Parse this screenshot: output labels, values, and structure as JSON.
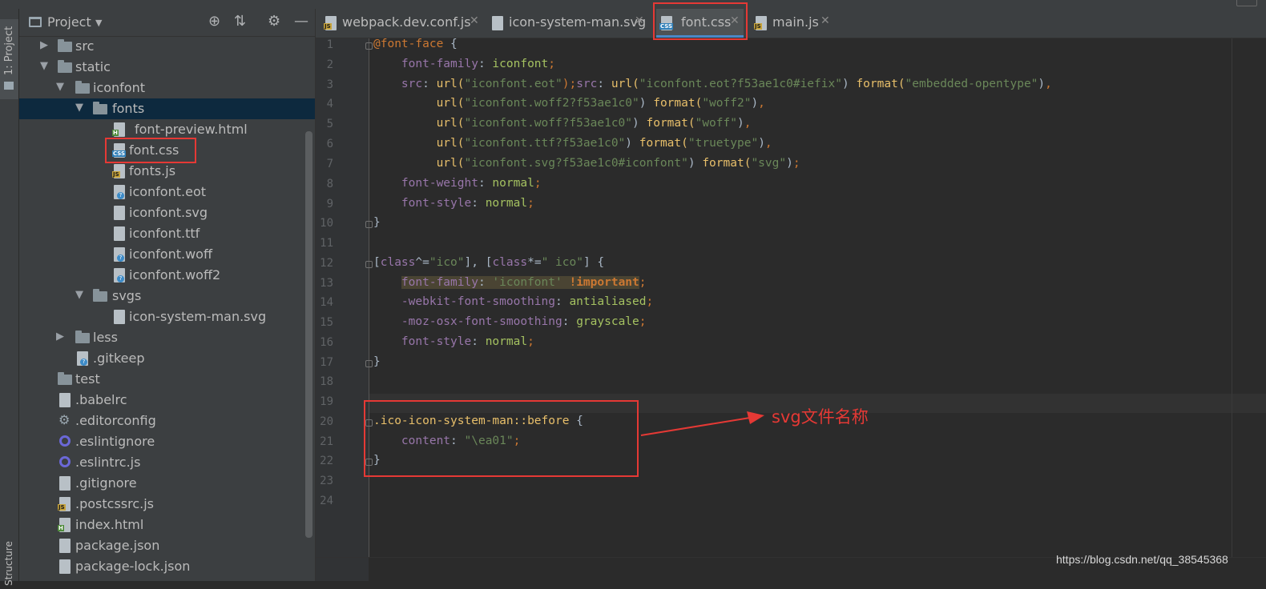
{
  "toolwindow_tabs": {
    "project": "1: Project",
    "structure": "Structure"
  },
  "project_panel": {
    "title": "Project",
    "dropdown_icon": "triangle-down",
    "header_icons": [
      "locate-icon",
      "collapse-icon",
      "gear-icon",
      "minimize-icon"
    ],
    "tree": [
      {
        "label": "src",
        "type": "folder",
        "expanded": false
      },
      {
        "label": "static",
        "type": "folder",
        "expanded": true
      },
      {
        "label": "iconfont",
        "type": "folder",
        "expanded": true
      },
      {
        "label": "fonts",
        "type": "folder",
        "expanded": true,
        "selected": true
      },
      {
        "label": "font-preview.html",
        "type": "html"
      },
      {
        "label": "font.css",
        "type": "css",
        "highlighted": true
      },
      {
        "label": "fonts.js",
        "type": "js"
      },
      {
        "label": "iconfont.eot",
        "type": "unknown"
      },
      {
        "label": "iconfont.svg",
        "type": "svg"
      },
      {
        "label": "iconfont.ttf",
        "type": "text"
      },
      {
        "label": "iconfont.woff",
        "type": "unknown"
      },
      {
        "label": "iconfont.woff2",
        "type": "unknown"
      },
      {
        "label": "svgs",
        "type": "folder",
        "expanded": true
      },
      {
        "label": "icon-system-man.svg",
        "type": "svg"
      },
      {
        "label": "less",
        "type": "folder",
        "expanded": false
      },
      {
        "label": ".gitkeep",
        "type": "unknown"
      },
      {
        "label": "test",
        "type": "folder"
      },
      {
        "label": ".babelrc",
        "type": "config"
      },
      {
        "label": ".editorconfig",
        "type": "gear"
      },
      {
        "label": ".eslintignore",
        "type": "eslint"
      },
      {
        "label": ".eslintrc.js",
        "type": "eslint"
      },
      {
        "label": ".gitignore",
        "type": "config"
      },
      {
        "label": ".postcssrc.js",
        "type": "js"
      },
      {
        "label": "index.html",
        "type": "html"
      },
      {
        "label": "package.json",
        "type": "config"
      },
      {
        "label": "package-lock.json",
        "type": "config"
      }
    ]
  },
  "editor_tabs": [
    {
      "label": "webpack.dev.conf.js",
      "type": "js",
      "active": false
    },
    {
      "label": "icon-system-man.svg",
      "type": "svg",
      "active": false
    },
    {
      "label": "font.css",
      "type": "css",
      "active": true
    },
    {
      "label": "main.js",
      "type": "js",
      "active": false
    }
  ],
  "line_numbers": [
    "1",
    "2",
    "3",
    "4",
    "5",
    "6",
    "7",
    "8",
    "9",
    "10",
    "11",
    "12",
    "13",
    "14",
    "15",
    "16",
    "17",
    "18",
    "19",
    "20",
    "21",
    "22",
    "23",
    "24"
  ],
  "code": {
    "l1_at": "@font-face",
    "l1_brace": " {",
    "l2_prop": "font-family",
    "l2_val": "iconfont",
    "l3_prop": "src",
    "l3_fn1": "url(",
    "l3_s1": "\"iconfont.eot\"",
    "l3_mid": ");",
    "l3_prop2": "src",
    "l3_fn2": "url(",
    "l3_s2": "\"iconfont.eot?f53ae1c0#iefix\"",
    "l3_fmt": "format(",
    "l3_s3": "\"embedded-opentype\"",
    "l4_s": "\"iconfont.woff2?f53ae1c0\"",
    "l4_f": "\"woff2\"",
    "l5_s": "\"iconfont.woff?f53ae1c0\"",
    "l5_f": "\"woff\"",
    "l6_s": "\"iconfont.ttf?f53ae1c0\"",
    "l6_f": "\"truetype\"",
    "l7_s": "\"iconfont.svg?f53ae1c0#iconfont\"",
    "l7_f": "\"svg\"",
    "l8_prop": "font-weight",
    "l8_val": "normal",
    "l9_prop": "font-style",
    "l9_val": "normal",
    "l12_sel1": "class",
    "l12_op1": "^=",
    "l12_s1": "\"ico\"",
    "l12_sel2": "class",
    "l12_op2": "*=",
    "l12_s2": "\" ico\"",
    "l13_prop": "font-family",
    "l13_val": "'iconfont'",
    "l13_imp": "!important",
    "l14_prop": "-webkit-font-smoothing",
    "l14_val": "antialiased",
    "l15_prop": "-moz-osx-font-smoothing",
    "l15_val": "grayscale",
    "l16_prop": "font-style",
    "l16_val": "normal",
    "l20_sel": ".ico-icon-system-man",
    "l20_pseudo": "::before",
    "l21_prop": "content",
    "l21_val": "\"\\ea01\""
  },
  "annotation": "svg文件名称",
  "watermark": "https://blog.csdn.net/qq_38545368",
  "highlight_color": "#e53935"
}
